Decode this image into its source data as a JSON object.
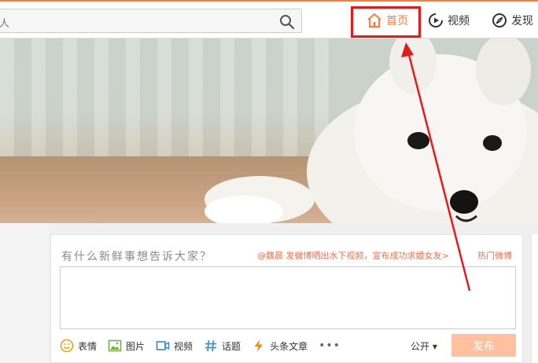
{
  "search": {
    "placeholder": "人"
  },
  "nav": {
    "home_label": "首页",
    "video_label": "视频",
    "discover_label": "发现"
  },
  "composer": {
    "prompt": "有什么新鲜事想告诉大家？",
    "promo_text": "@魏晨 发微博晒出水下视频，宣布成功求婚女友>",
    "hot_label": "热门微博",
    "tools": {
      "emoji": "表情",
      "image": "图片",
      "video": "视频",
      "topic": "话题",
      "article": "头条文章",
      "more": "•••"
    },
    "visibility": "公开 ▾",
    "publish": "发布"
  },
  "colors": {
    "accent": "#fa7d3c",
    "annotation_red": "#e31b1b",
    "publish_disabled": "#ffc09f"
  }
}
